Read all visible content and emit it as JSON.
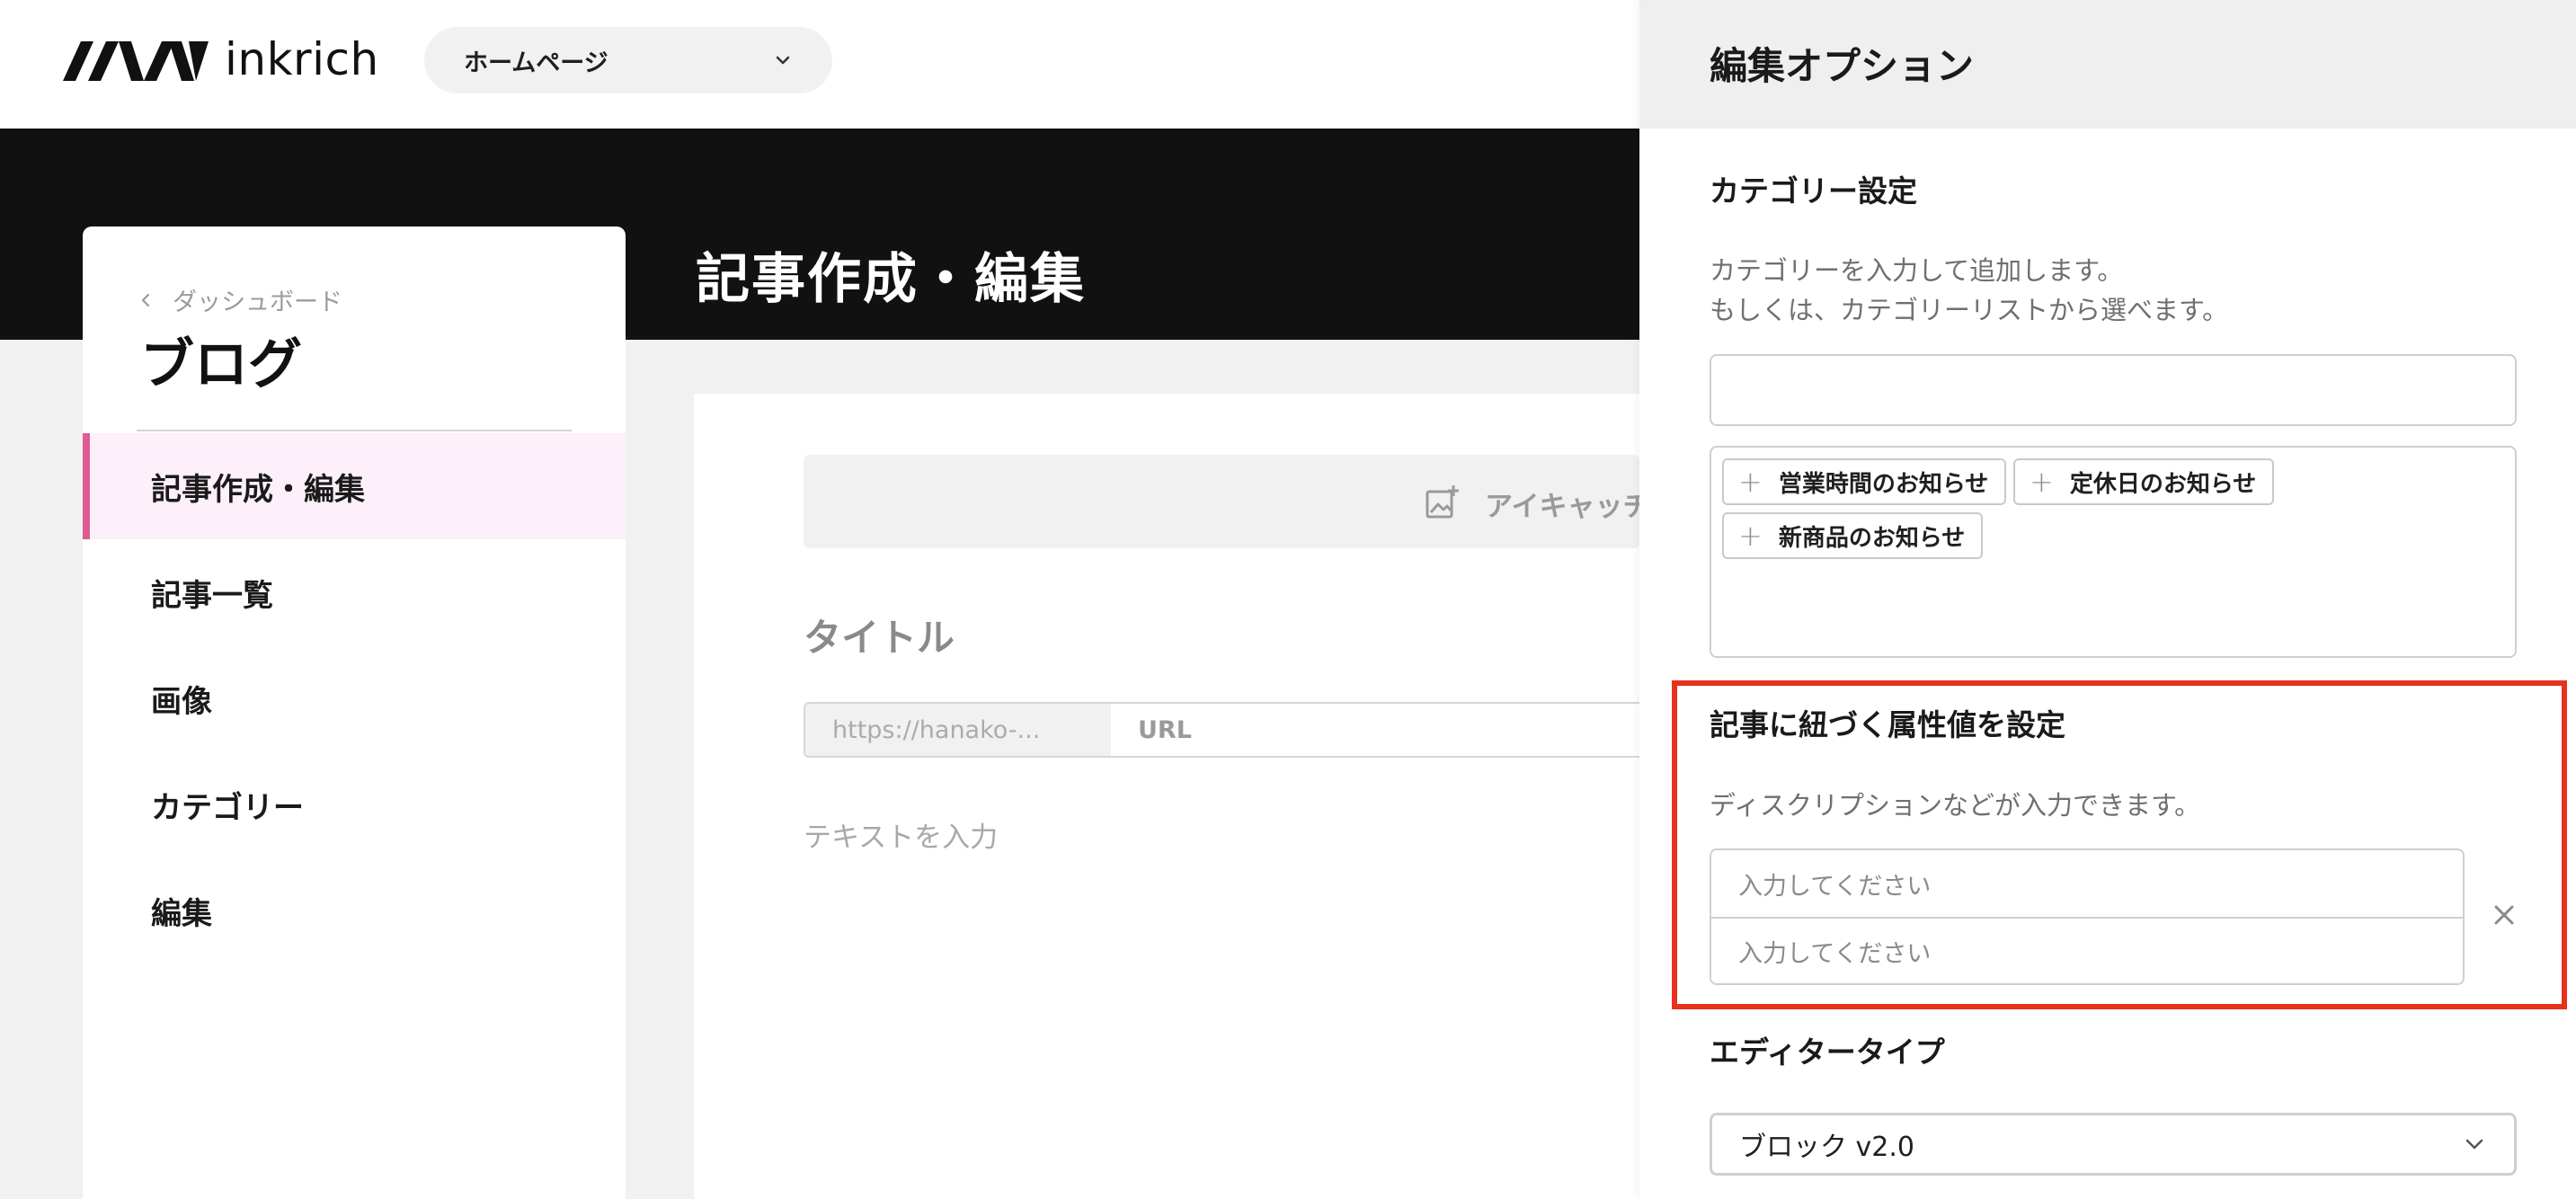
{
  "header": {
    "logo_text": "inkrich",
    "page_select_label": "ホームページ"
  },
  "hero": {
    "title": "記事作成・編集"
  },
  "sidebar": {
    "breadcrumb": "ダッシュボード",
    "title": "ブログ",
    "items": [
      {
        "label": "記事作成・編集",
        "active": true
      },
      {
        "label": "記事一覧",
        "active": false
      },
      {
        "label": "画像",
        "active": false
      },
      {
        "label": "カテゴリー",
        "active": false
      },
      {
        "label": "編集",
        "active": false
      }
    ]
  },
  "editor": {
    "eyecatch_label": "アイキャッチ",
    "title_placeholder": "タイトル",
    "url_prefix": "https://hanako-...",
    "url_placeholder": "URL",
    "body_placeholder": "テキストを入力"
  },
  "panel": {
    "title": "編集オプション",
    "category": {
      "heading": "カテゴリー設定",
      "desc_line1": "カテゴリーを入力して追加します。",
      "desc_line2": "もしくは、カテゴリーリストから選べます。",
      "input_value": "",
      "chips": [
        "営業時間のお知らせ",
        "定休日のお知らせ",
        "新商品のお知らせ"
      ]
    },
    "attributes": {
      "heading": "記事に紐づく属性値を設定",
      "desc": "ディスクリプションなどが入力できます。",
      "key_placeholder": "入力してください",
      "value_placeholder": "入力してください"
    },
    "editor_type": {
      "heading": "エディタータイプ",
      "selected": "ブロック v2.0"
    }
  },
  "colors": {
    "accent_pink": "#e05a94",
    "active_bg": "#fdf0fa",
    "highlight_red": "#e7321d",
    "hero_black": "#111111"
  }
}
